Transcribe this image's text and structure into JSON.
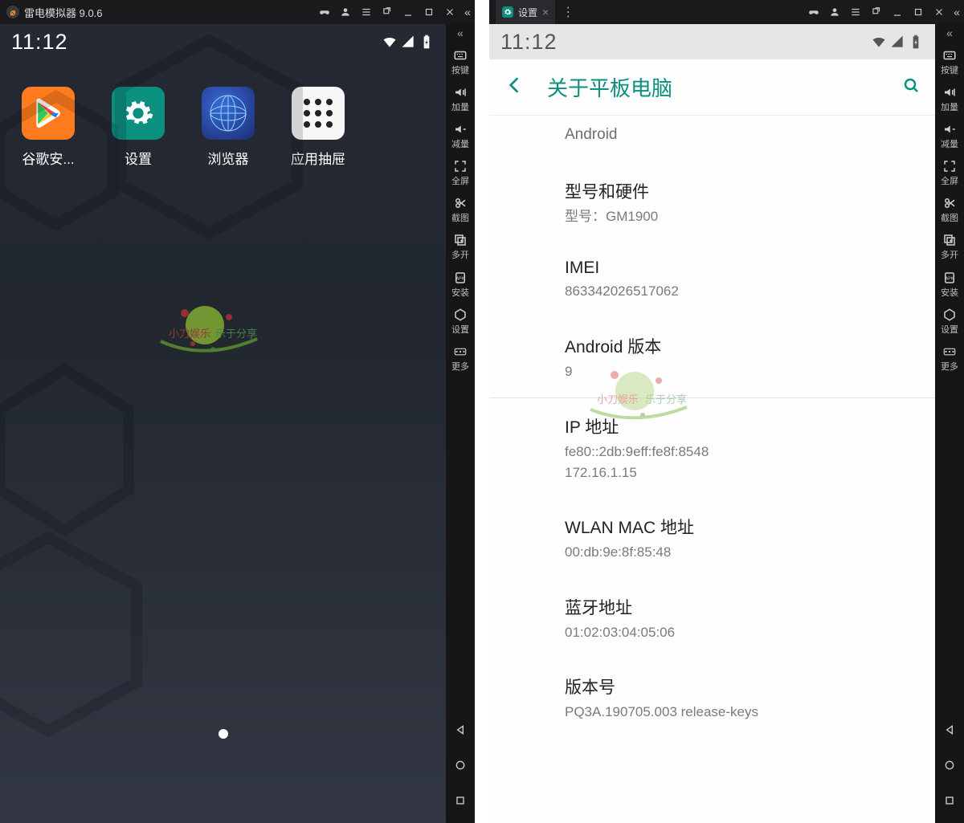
{
  "left": {
    "window_title": "雷电模拟器 9.0.6",
    "status_time": "11:12",
    "apps": [
      {
        "label": "谷歌安...",
        "icon": "google-installer"
      },
      {
        "label": "设置",
        "icon": "settings"
      },
      {
        "label": "浏览器",
        "icon": "browser"
      },
      {
        "label": "应用抽屉",
        "icon": "app-drawer"
      }
    ]
  },
  "right": {
    "tab_label": "设置",
    "status_time": "11:12",
    "page_title": "关于平板电脑",
    "items": [
      {
        "title": "",
        "value": "Android"
      },
      {
        "title": "型号和硬件",
        "value": "型号：GM1900"
      },
      {
        "title": "IMEI",
        "value": "863342026517062"
      },
      {
        "title": "Android 版本",
        "value": "9"
      },
      {
        "title": "IP 地址",
        "value": "fe80::2db:9eff:fe8f:8548\n172.16.1.15"
      },
      {
        "title": "WLAN MAC 地址",
        "value": "00:db:9e:8f:85:48"
      },
      {
        "title": "蓝牙地址",
        "value": "01:02:03:04:05:06"
      },
      {
        "title": "版本号",
        "value": "PQ3A.190705.003 release-keys"
      }
    ]
  },
  "side_items": [
    {
      "label": "按键",
      "icon": "keyboard"
    },
    {
      "label": "加量",
      "icon": "vol-up"
    },
    {
      "label": "减量",
      "icon": "vol-down"
    },
    {
      "label": "全屏",
      "icon": "fullscreen"
    },
    {
      "label": "截图",
      "icon": "scissors"
    },
    {
      "label": "多开",
      "icon": "multi"
    },
    {
      "label": "安装",
      "icon": "apk"
    },
    {
      "label": "设置",
      "icon": "hex"
    },
    {
      "label": "更多",
      "icon": "more"
    }
  ]
}
